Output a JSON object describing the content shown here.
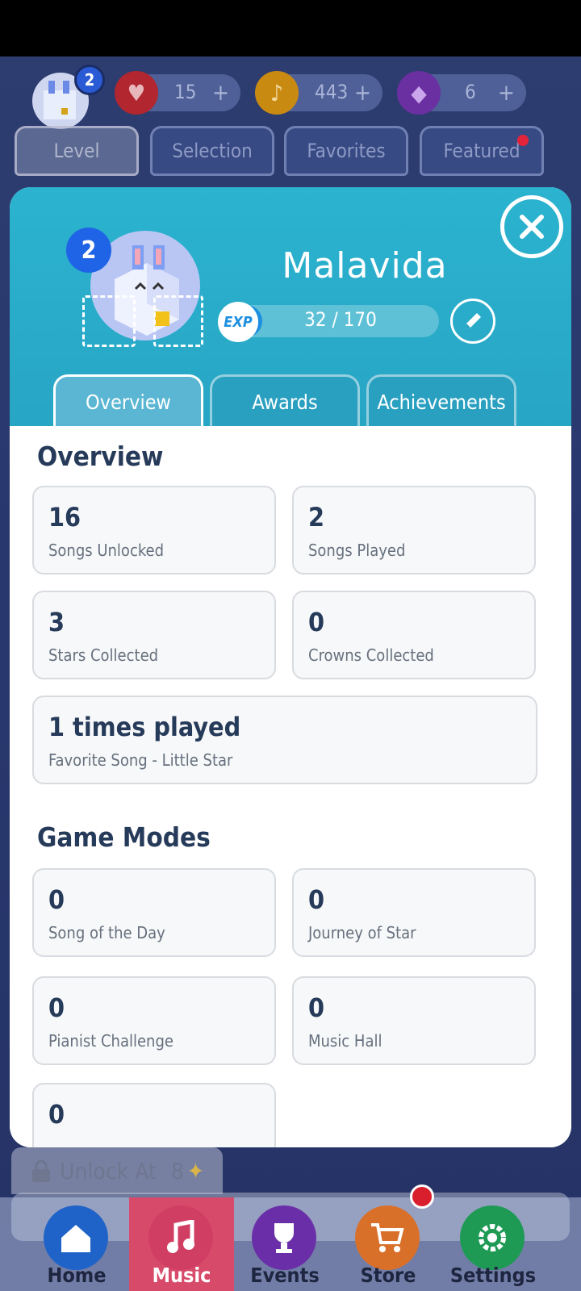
{
  "topbar": {
    "avatar_level": "2",
    "lives": "15",
    "notes": "443",
    "gems": "6",
    "plus": "+"
  },
  "top_tabs": [
    "Level",
    "Selection",
    "Favorites",
    "Featured"
  ],
  "profile": {
    "level": "2",
    "name": "Malavida",
    "exp_label": "EXP",
    "exp_text": "32 / 170",
    "exp_fraction": 0.188
  },
  "profile_tabs": [
    "Overview",
    "Awards",
    "Achievements"
  ],
  "overview": {
    "title": "Overview",
    "stats": [
      {
        "value": "16",
        "label": "Songs Unlocked"
      },
      {
        "value": "2",
        "label": "Songs Played"
      },
      {
        "value": "3",
        "label": "Stars Collected"
      },
      {
        "value": "0",
        "label": "Crowns Collected"
      }
    ],
    "favorite": {
      "value": "1 times played",
      "label": "Favorite Song - Little Star"
    }
  },
  "game_modes": {
    "title": "Game Modes",
    "stats": [
      {
        "value": "0",
        "label": "Song of the Day"
      },
      {
        "value": "0",
        "label": "Journey of Star"
      },
      {
        "value": "0",
        "label": "Pianist Challenge"
      },
      {
        "value": "0",
        "label": "Music Hall"
      },
      {
        "value": "0",
        "label": ""
      }
    ]
  },
  "unlock": {
    "text": "Unlock At",
    "value": "8"
  },
  "nav": [
    "Home",
    "Music",
    "Events",
    "Store",
    "Settings"
  ],
  "colors": {
    "header": "#2bb3cf",
    "accent_blue": "#1f63e6",
    "text_dark": "#263a5a",
    "music_active": "#d74a6a"
  }
}
